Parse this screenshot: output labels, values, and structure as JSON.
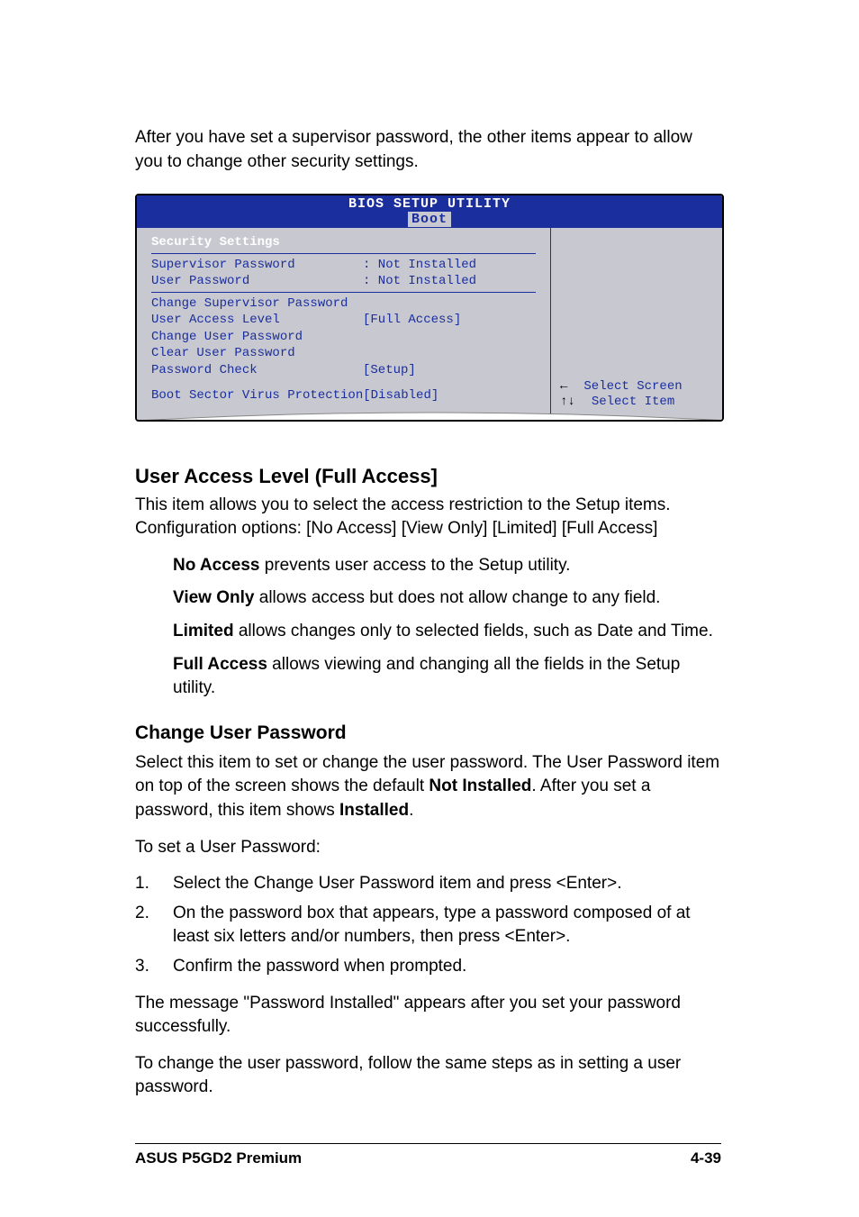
{
  "intro": "After you have set a supervisor password, the other items appear to allow you to change other security settings.",
  "bios": {
    "title": "BIOS SETUP UTILITY",
    "tab": "Boot",
    "section_title": "Security Settings",
    "status": [
      {
        "label": "Supervisor Password",
        "value": ": Not Installed"
      },
      {
        "label": "User Password",
        "value": ": Not Installed"
      }
    ],
    "items": [
      {
        "label": "Change Supervisor Password",
        "value": ""
      },
      {
        "label": "User Access Level",
        "value": "[Full Access]"
      },
      {
        "label": "Change User Password",
        "value": ""
      },
      {
        "label": "Clear User Password",
        "value": ""
      },
      {
        "label": "Password Check",
        "value": "[Setup]"
      }
    ],
    "boot_item": {
      "label": "Boot Sector Virus Protection",
      "value": "[Disabled]"
    },
    "help": [
      {
        "icon": "←",
        "label": "Select Screen"
      },
      {
        "icon": "↑↓",
        "label": "Select Item"
      }
    ]
  },
  "section1": {
    "heading": "User Access Level (Full Access]",
    "intro": "This item allows you to select the access restriction to the Setup items. Configuration options: [No Access] [View Only] [Limited] [Full Access]",
    "options": [
      {
        "bold": "No Access",
        "text": " prevents user access to the Setup utility."
      },
      {
        "bold": "View Only",
        "text": " allows access but does not allow change to any field."
      },
      {
        "bold": "Limited",
        "text": " allows changes only to selected fields, such as Date and Time."
      },
      {
        "bold": "Full Access",
        "text": " allows viewing and changing all the fields in the Setup utility."
      }
    ]
  },
  "section2": {
    "heading": "Change User Password",
    "intro_pre": "Select this item to set or change the user password. The User Password item on top of the screen shows the default ",
    "intro_bold1": "Not Installed",
    "intro_mid": ". After you set a password, this item shows ",
    "intro_bold2": "Installed",
    "intro_end": ".",
    "lead": "To set a User Password:",
    "steps": [
      "Select the Change User Password item and press <Enter>.",
      "On the password box that appears, type a password composed of at least six letters and/or numbers, then press <Enter>.",
      "Confirm the password when prompted."
    ],
    "after": "The message \"Password Installed\" appears after you set your password successfully.",
    "after2": "To change the user password, follow the same steps as in setting a user password."
  },
  "footer": {
    "left": "ASUS P5GD2 Premium",
    "right": "4-39"
  }
}
